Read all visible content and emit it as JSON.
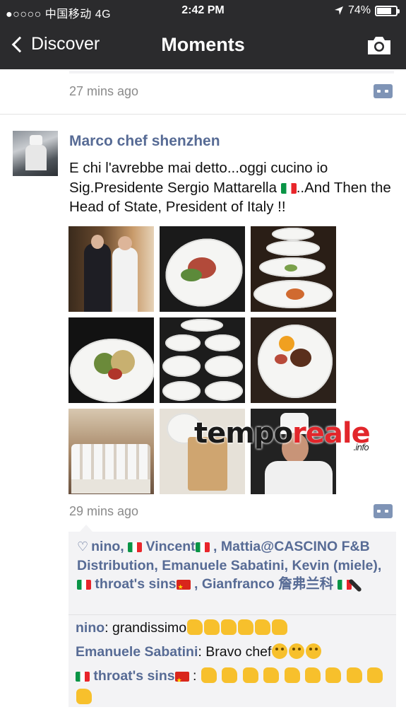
{
  "status": {
    "carrier": "●○○○○ 中国移动  4G",
    "time": "2:42 PM",
    "battery": "74%"
  },
  "nav": {
    "back_label": "Discover",
    "title": "Moments"
  },
  "prev_post": {
    "time": "27 mins ago"
  },
  "post": {
    "author": "Marco chef shenzhen",
    "text_1": "E chi l'avrebbe mai detto...oggi cucino io Sig.Presidente Sergio Mattarella ",
    "text_2": "..And Then the Head of State, President of Italy !!",
    "time": "29 mins ago"
  },
  "watermark": {
    "main_1": "tempo",
    "main_2": "reale",
    "sub": ".info"
  },
  "likes": {
    "n1": "nino, ",
    "n2": " Vincent",
    "n3": " , Mattia@CASCINO F&B Distribution, Emanuele Sabatini, Kevin (miele), ",
    "n4": " throat's sins",
    "n5": " , Gianfranco 詹弗兰科 "
  },
  "comments": [
    {
      "author": "nino",
      "text": ": grandissimo"
    },
    {
      "author": "Emanuele Sabatini",
      "text": ": Bravo chef"
    },
    {
      "author": " throat's sins",
      "text": " : "
    }
  ]
}
